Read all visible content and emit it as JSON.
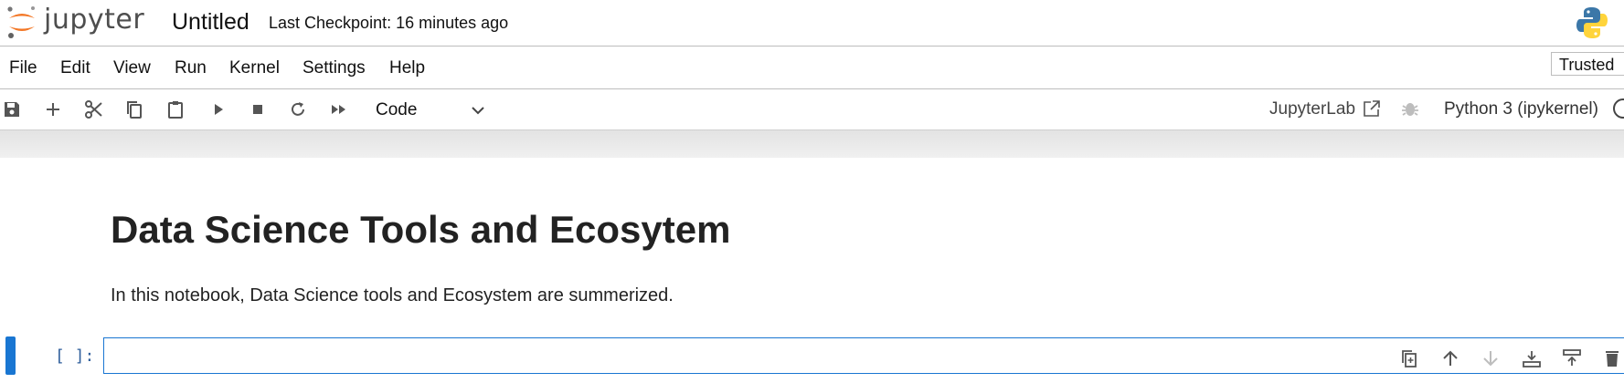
{
  "header": {
    "logo_text": "jupyter",
    "notebook_title": "Untitled",
    "checkpoint": "Last Checkpoint: 16 minutes ago"
  },
  "menu": {
    "items": [
      "File",
      "Edit",
      "View",
      "Run",
      "Kernel",
      "Settings",
      "Help"
    ],
    "trusted": "Trusted"
  },
  "toolbar": {
    "cell_type": "Code",
    "jupyterlab_link": "JupyterLab",
    "kernel_name": "Python 3 (ipykernel)",
    "icons": [
      "save-icon",
      "add-icon",
      "cut-icon",
      "copy-icon",
      "paste-icon",
      "run-icon",
      "stop-icon",
      "restart-icon",
      "fast-forward-icon"
    ]
  },
  "notebook": {
    "markdown_heading": "Data Science Tools and Ecosytem",
    "markdown_text": "In this notebook, Data Science tools and Ecosystem are summerized.",
    "code_prompt": "[ ]:"
  },
  "colors": {
    "accent": "#1976d2",
    "jupyter_orange": "#f37726",
    "prompt": "#305f9c"
  }
}
